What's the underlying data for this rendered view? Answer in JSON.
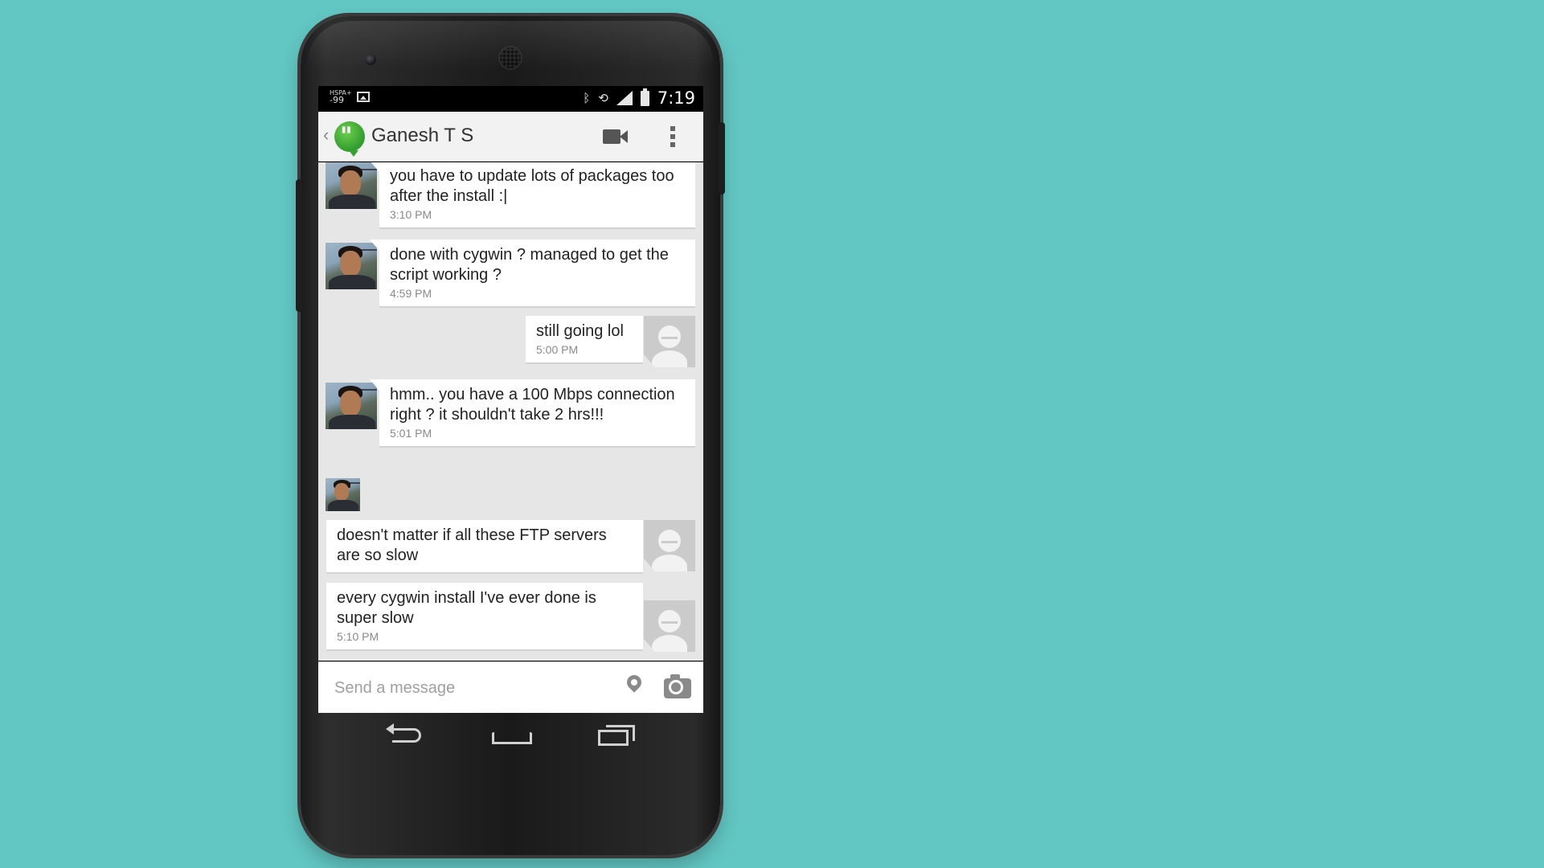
{
  "status_bar": {
    "network_label": "HSPA+",
    "signal_value": "-99",
    "time": "7:19",
    "icons": [
      "image-notification-icon",
      "bluetooth-icon",
      "rotation-icon",
      "signal-h-icon",
      "battery-icon"
    ]
  },
  "action_bar": {
    "back_glyph": "‹",
    "app_icon": "hangouts-icon",
    "contact_name": "Ganesh T S",
    "actions": [
      "video-call-icon",
      "overflow-menu-icon"
    ]
  },
  "messages": [
    {
      "direction": "incoming",
      "text": "you have to update lots of packages too after the install :|",
      "time": "3:10 PM"
    },
    {
      "direction": "incoming",
      "text": "done with cygwin ? managed to get the script working ?",
      "time": "4:59 PM"
    },
    {
      "direction": "outgoing",
      "text": "still going lol",
      "time": "5:00 PM"
    },
    {
      "direction": "incoming",
      "text": "hmm.. you have a 100 Mbps connection right ? it shouldn't take 2 hrs!!!",
      "time": "5:01 PM"
    },
    {
      "direction": "outgoing",
      "text": "doesn't matter if all these FTP servers are so slow",
      "time": ""
    },
    {
      "direction": "outgoing",
      "text": "every cygwin install I've ever done is super slow",
      "time": "5:10 PM"
    }
  ],
  "compose": {
    "placeholder": "Send a message",
    "icons": [
      "location-pin-icon",
      "camera-icon"
    ]
  },
  "nav_bar": {
    "buttons": [
      "back-icon",
      "home-icon",
      "recent-apps-icon"
    ]
  },
  "colors": {
    "background": "#62c6c2",
    "hangouts_green": "#3fa83a",
    "chat_background": "#e6e6e6",
    "bubble": "#ffffff"
  }
}
